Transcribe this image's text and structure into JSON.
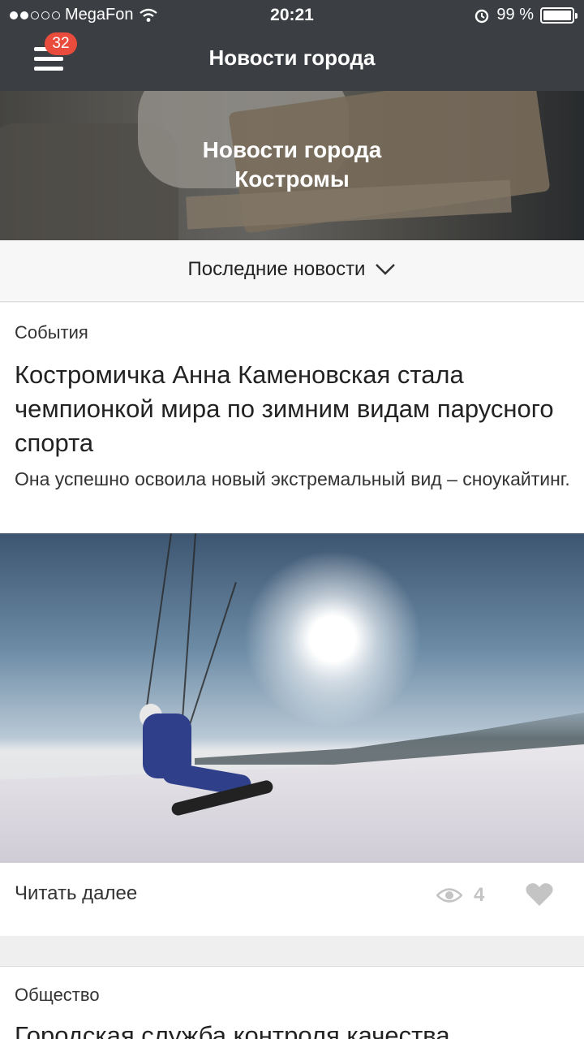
{
  "status_bar": {
    "carrier": "MegaFon",
    "time": "20:21",
    "battery": "99 %"
  },
  "nav": {
    "badge_count": "32",
    "title": "Новости города"
  },
  "hero": {
    "title_line1": "Новости города",
    "title_line2": "Костромы"
  },
  "filter": {
    "label": "Последние новости"
  },
  "articles": [
    {
      "category": "События",
      "headline": "Костромичка Анна Каменовская стала чемпионкой мира по зимним видам парусного спорта",
      "lede": "Она успешно освоила новый экстремальный вид – сноукайтинг.",
      "read_more": "Читать далее",
      "views": "4"
    },
    {
      "category": "Общество",
      "headline": "Городская служба контроля качества"
    }
  ]
}
